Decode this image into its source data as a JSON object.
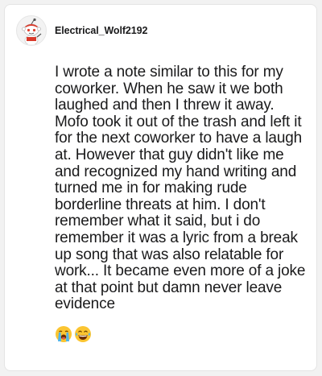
{
  "comment": {
    "author": {
      "username": "Electrical_Wolf2192",
      "avatar_icon": "snoo-avatar-icon"
    },
    "body": "I wrote a note similar to this for my coworker. When he saw it we both laughed and then I threw it away. Mofo took it out of the trash and left it for the next coworker to have a laugh at. However that guy didn't like me and recognized my hand writing and turned me in for making rude borderline threats at him. I don't remember what it said, but i do remember it was a lyric from a break up song that was also relatable for work... It became even more of a joke at that point but damn never leave evidence",
    "emojis": [
      {
        "name": "loudly-crying-face-icon",
        "char": "😭"
      },
      {
        "name": "face-with-tears-of-joy-icon",
        "char": "😂"
      }
    ]
  },
  "colors": {
    "background": "#f2f2f2",
    "card": "#ffffff",
    "text": "#1a1a1b",
    "emoji_yellow": "#fbc531",
    "tear_blue": "#4fb5ee"
  }
}
